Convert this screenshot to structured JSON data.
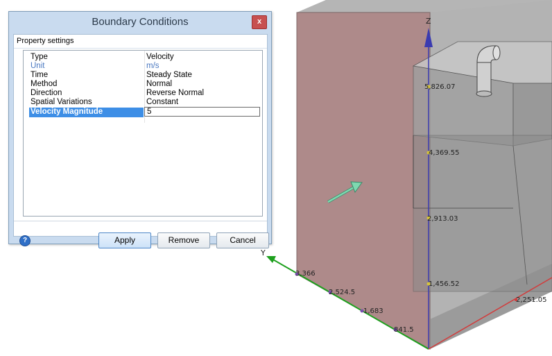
{
  "dialog": {
    "title": "Boundary Conditions",
    "close_glyph": "x",
    "section_label": "Property settings",
    "properties": [
      {
        "name": "Type",
        "value": "Velocity"
      },
      {
        "name": "Unit",
        "value": "m/s"
      },
      {
        "name": "Time",
        "value": "Steady State"
      },
      {
        "name": "Method",
        "value": "Normal"
      },
      {
        "name": "Direction",
        "value": "Reverse Normal"
      },
      {
        "name": "Spatial Variations",
        "value": "Constant"
      },
      {
        "name": "Velocity Magnitude",
        "value": "5"
      }
    ],
    "help_glyph": "?",
    "help_icon": "help-circle-icon",
    "buttons": {
      "apply": "Apply",
      "remove": "Remove",
      "cancel": "Cancel"
    }
  },
  "viewport": {
    "axes": {
      "z": "Z",
      "y": "Y"
    },
    "z_ticks": [
      "5,826.07",
      "4,369.55",
      "2,913.03",
      "1,456.52"
    ],
    "y_ticks": [
      "3,366",
      "2,524.5",
      "1,683",
      "841.5"
    ],
    "x_tick": "2,251.05",
    "colors": {
      "boundary_face": "#a07676",
      "box_face": "#8f8f8f",
      "y_axis": "#1ea01e",
      "z_axis": "#3b3bb0",
      "x_axis": "#d23c3c",
      "velocity_arrow": "#7ed8b0"
    }
  }
}
